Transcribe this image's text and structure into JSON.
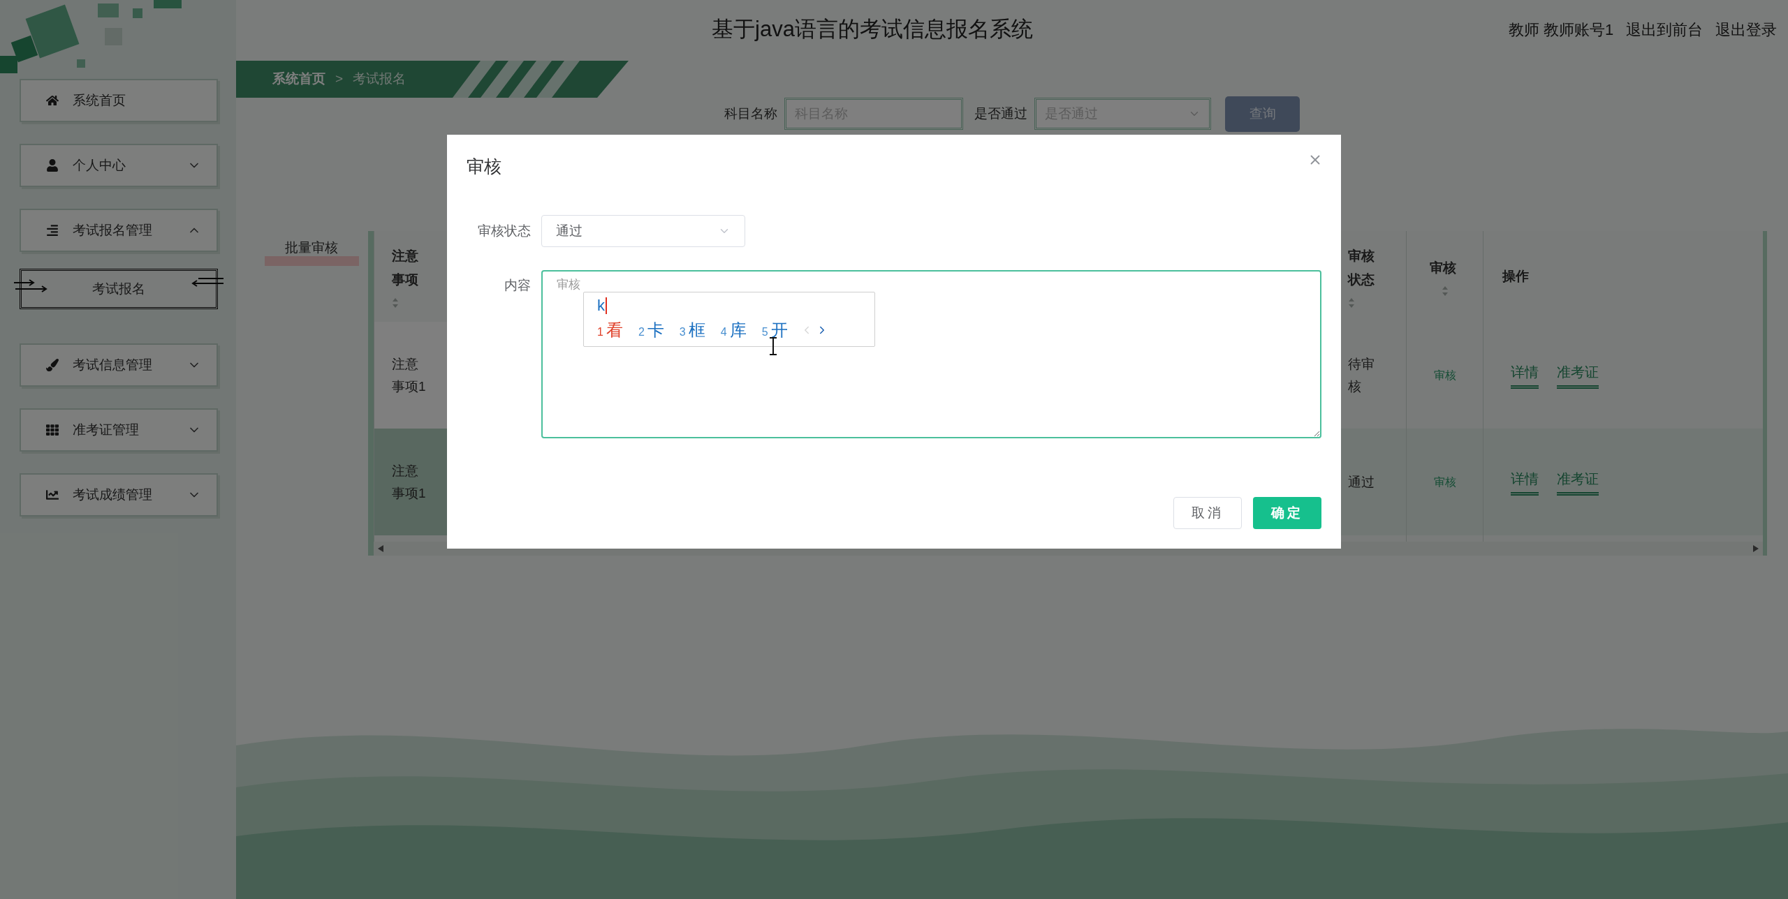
{
  "header": {
    "title": "基于java语言的考试信息报名系统",
    "user": "教师 教师账号1",
    "links": [
      "退出到前台",
      "退出登录"
    ]
  },
  "sidebar": {
    "items": [
      {
        "label": "系统首页",
        "kind": "link"
      },
      {
        "label": "个人中心",
        "kind": "menu",
        "expanded": false
      },
      {
        "label": "考试报名管理",
        "kind": "menu",
        "expanded": true,
        "children": [
          {
            "label": "考试报名",
            "selected": true
          }
        ]
      },
      {
        "label": "考试信息管理",
        "kind": "menu",
        "expanded": false
      },
      {
        "label": "准考证管理",
        "kind": "menu",
        "expanded": false
      },
      {
        "label": "考试成绩管理",
        "kind": "menu",
        "expanded": false
      }
    ]
  },
  "breadcrumb": {
    "items": [
      "系统首页",
      "考试报名"
    ],
    "separator": ">"
  },
  "search": {
    "fields": [
      {
        "label": "科目名称",
        "kind": "input",
        "placeholder": "科目名称"
      },
      {
        "label": "是否通过",
        "kind": "select",
        "placeholder": "是否通过"
      }
    ],
    "button": "查询"
  },
  "batch_button": "批量审核",
  "table": {
    "columns": [
      {
        "label": "注意事项",
        "sortable": true
      },
      {
        "label": "审核状态",
        "sortable": true
      },
      {
        "label": "审核",
        "sortable": true
      },
      {
        "label": "操作",
        "sortable": false
      }
    ],
    "rows": [
      {
        "highlighted": false,
        "notes": "注意事项1",
        "status": "待审核",
        "review": "审核",
        "actions": [
          "详情",
          "准考证"
        ]
      },
      {
        "highlighted": true,
        "notes": "注意事项1",
        "status": "通过",
        "review": "审核",
        "actions": [
          "详情",
          "准考证"
        ]
      }
    ]
  },
  "dialog": {
    "title": "审核",
    "fields": [
      {
        "label": "审核状态",
        "kind": "select",
        "value": "通过"
      },
      {
        "label": "内容",
        "kind": "textarea",
        "placeholder": "审核"
      }
    ],
    "buttons": [
      {
        "label": "取消",
        "kind": "default"
      },
      {
        "label": "确定",
        "kind": "primary"
      }
    ]
  },
  "ime": {
    "input": "k",
    "candidates": [
      {
        "index": "1",
        "text": "看",
        "selected": true
      },
      {
        "index": "2",
        "text": "卡",
        "selected": false
      },
      {
        "index": "3",
        "text": "框",
        "selected": false
      },
      {
        "index": "4",
        "text": "库",
        "selected": false
      },
      {
        "index": "5",
        "text": "开",
        "selected": false
      }
    ],
    "prev_disabled": true,
    "next_disabled": false
  }
}
